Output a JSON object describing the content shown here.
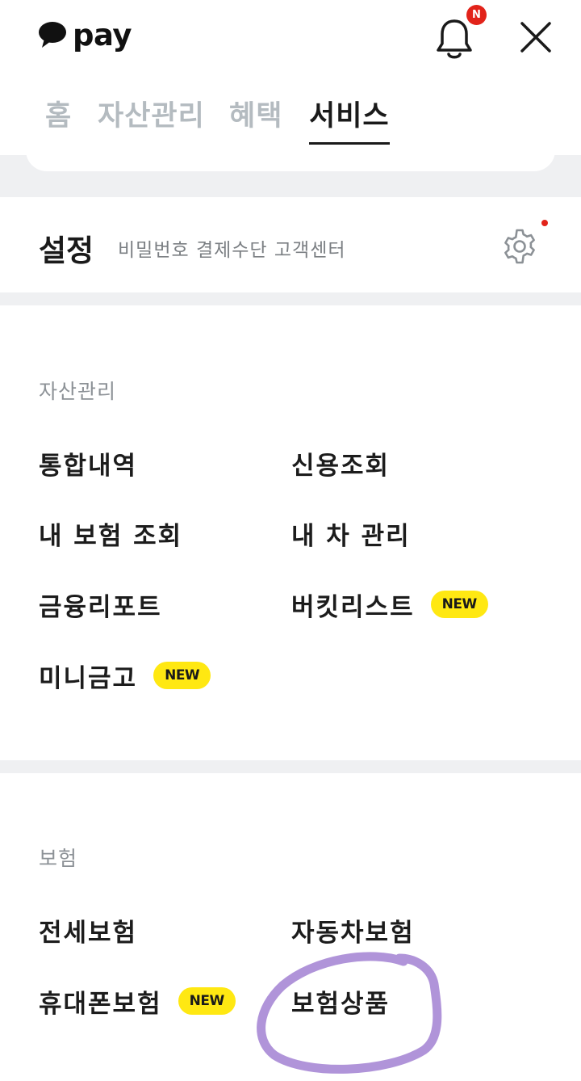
{
  "header": {
    "logo_text": "pay",
    "notification_badge": "N"
  },
  "tabs": [
    {
      "label": "홈",
      "active": false
    },
    {
      "label": "자산관리",
      "active": false
    },
    {
      "label": "혜택",
      "active": false
    },
    {
      "label": "서비스",
      "active": true
    }
  ],
  "settings": {
    "title": "설정",
    "description": "비밀번호 결제수단 고객센터"
  },
  "asset_section": {
    "label": "자산관리",
    "items": [
      {
        "label": "통합내역"
      },
      {
        "label": "신용조회"
      },
      {
        "label": "내 보험 조회"
      },
      {
        "label": "내 차 관리"
      },
      {
        "label": "금융리포트"
      },
      {
        "label": "버킷리스트",
        "badge": "NEW"
      },
      {
        "label": "미니금고",
        "badge": "NEW"
      }
    ]
  },
  "insurance_section": {
    "label": "보험",
    "items": [
      {
        "label": "전세보험"
      },
      {
        "label": "자동차보험"
      },
      {
        "label": "휴대폰보험",
        "badge": "NEW"
      },
      {
        "label": "보험상품"
      }
    ]
  },
  "colors": {
    "accent_yellow": "#ffe812",
    "badge_red": "#e2231a",
    "annotation_purple": "#a98bd6",
    "section_gray": "#eff0f2"
  }
}
